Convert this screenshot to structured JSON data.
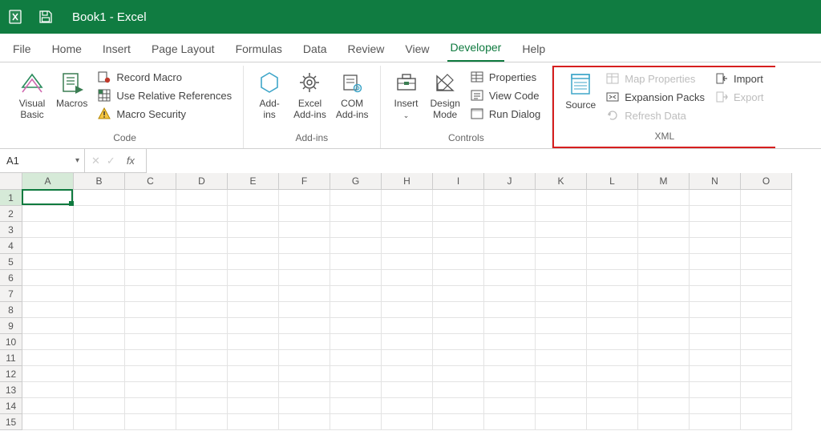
{
  "title": "Book1  -  Excel",
  "tabs": [
    "File",
    "Home",
    "Insert",
    "Page Layout",
    "Formulas",
    "Data",
    "Review",
    "View",
    "Developer",
    "Help"
  ],
  "active_tab": "Developer",
  "ribbon": {
    "code": {
      "label": "Code",
      "visual_basic": "Visual\nBasic",
      "macros": "Macros",
      "record_macro": "Record Macro",
      "use_rel_ref": "Use Relative References",
      "macro_security": "Macro Security"
    },
    "addins": {
      "label": "Add-ins",
      "add_ins": "Add-\nins",
      "excel_addins": "Excel\nAdd-ins",
      "com_addins": "COM\nAdd-ins"
    },
    "controls": {
      "label": "Controls",
      "insert": "Insert",
      "design_mode": "Design\nMode",
      "properties": "Properties",
      "view_code": "View Code",
      "run_dialog": "Run Dialog"
    },
    "xml": {
      "label": "XML",
      "source": "Source",
      "map_properties": "Map Properties",
      "expansion_packs": "Expansion Packs",
      "refresh_data": "Refresh Data",
      "import": "Import",
      "export": "Export"
    }
  },
  "namebox_value": "A1",
  "formula_value": "",
  "columns": [
    "A",
    "B",
    "C",
    "D",
    "E",
    "F",
    "G",
    "H",
    "I",
    "J",
    "K",
    "L",
    "M",
    "N",
    "O"
  ],
  "rows": [
    "1",
    "2",
    "3",
    "4",
    "5",
    "6",
    "7",
    "8",
    "9",
    "10",
    "11",
    "12",
    "13",
    "14",
    "15"
  ],
  "selected_col": "A",
  "selected_row": "1"
}
